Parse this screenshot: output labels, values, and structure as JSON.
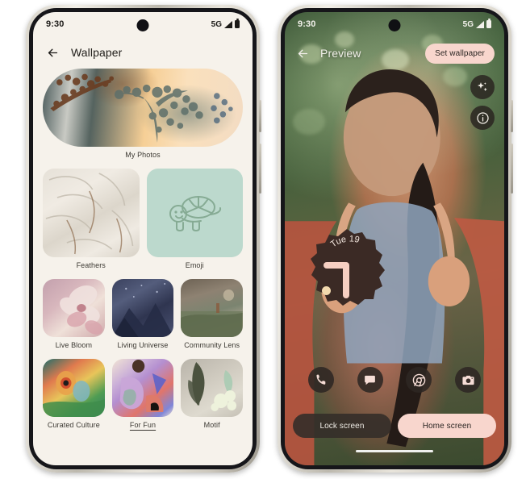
{
  "left_phone": {
    "status_bar": {
      "time": "9:30",
      "network": "5G",
      "signal_icon": "signal-bars-icon",
      "battery_icon": "battery-full-icon",
      "text_color": "#1b1916"
    },
    "app_bar": {
      "back_icon": "back-arrow-icon",
      "title": "Wallpaper"
    },
    "hero": {
      "label": "My Photos",
      "name": "my-photos-tile"
    },
    "grid_rows": [
      [
        {
          "label": "Feathers",
          "name": "feathers-tile",
          "focused": false
        },
        {
          "label": "Emoji",
          "name": "emoji-tile",
          "focused": false,
          "icon": "turtle-icon"
        }
      ],
      [
        {
          "label": "Live Bloom",
          "name": "live-bloom-tile",
          "focused": false
        },
        {
          "label": "Living Universe",
          "name": "living-universe-tile",
          "focused": false
        },
        {
          "label": "Community Lens",
          "name": "community-lens-tile",
          "focused": false
        }
      ],
      [
        {
          "label": "Curated Culture",
          "name": "curated-culture-tile",
          "focused": false
        },
        {
          "label": "For Fun",
          "name": "for-fun-tile",
          "focused": true
        },
        {
          "label": "Motif",
          "name": "motif-tile",
          "focused": false
        }
      ]
    ],
    "background_color": "#f6f2eb"
  },
  "right_phone": {
    "status_bar": {
      "time": "9:30",
      "network": "5G",
      "signal_icon": "signal-bars-icon",
      "battery_icon": "battery-full-icon",
      "text_color": "#f4f2ec"
    },
    "app_bar": {
      "back_icon": "back-arrow-icon",
      "title": "Preview",
      "set_wallpaper_label": "Set wallpaper"
    },
    "floating_buttons": [
      {
        "name": "ai-effects-button",
        "icon": "sparkle-icon"
      },
      {
        "name": "info-button",
        "icon": "info-icon"
      }
    ],
    "clock_widget": {
      "date": "Tue 19",
      "name": "clock-widget"
    },
    "shortcuts": [
      {
        "name": "phone-shortcut",
        "icon": "phone-icon"
      },
      {
        "name": "messages-shortcut",
        "icon": "message-bubble-icon"
      },
      {
        "name": "chrome-shortcut",
        "icon": "chrome-icon"
      },
      {
        "name": "camera-shortcut",
        "icon": "camera-icon"
      }
    ],
    "tabs": [
      {
        "label": "Lock screen",
        "name": "tab-lock-screen",
        "active": false
      },
      {
        "label": "Home screen",
        "name": "tab-home-screen",
        "active": true
      }
    ],
    "accent_color": "#f8d6cd"
  }
}
